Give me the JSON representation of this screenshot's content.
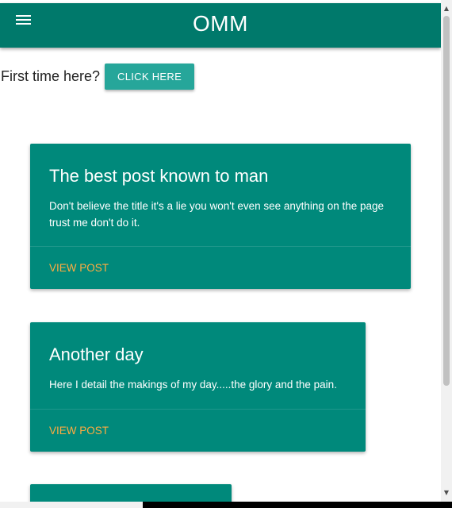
{
  "header": {
    "menu_icon": "hamburger-menu-icon",
    "title": "OMM"
  },
  "intro": {
    "text": "First time here?",
    "button_label": "CLICK HERE"
  },
  "posts": [
    {
      "title": "The best post known to man",
      "body": "Don't believe the title it's a lie you won't even see anything on the page trust me don't do it.",
      "action": "VIEW POST"
    },
    {
      "title": "Another day",
      "body": "Here I detail the makings of my day.....the glory and the pain.",
      "action": "VIEW POST"
    }
  ],
  "colors": {
    "appbar": "#00796b",
    "card": "#00897b",
    "button": "#26a69a",
    "link": "#ffab40"
  }
}
